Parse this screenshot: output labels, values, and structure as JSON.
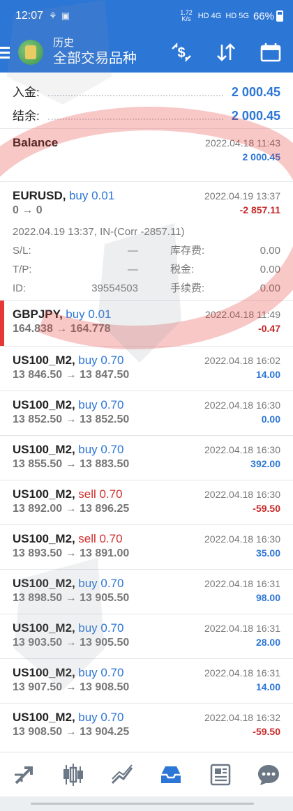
{
  "status": {
    "time": "12:07",
    "net_speed_top": "1.72",
    "net_speed_unit": "K/s",
    "signal_1": "HD 4G",
    "signal_2": "HD 5G",
    "battery": "66%"
  },
  "header": {
    "subtitle": "历史",
    "title": "全部交易品种"
  },
  "summary": {
    "deposit_label": "入金:",
    "deposit_value": "2 000.45",
    "balance_label": "结余:",
    "balance_value": "2 000.45"
  },
  "records": [
    {
      "symbol": "Balance",
      "side": "",
      "time": "2022.04.18 11:43",
      "prices": "",
      "profit": "2 000.45",
      "profit_sign": "pos"
    },
    {
      "symbol": "EURUSD,",
      "side": "buy 0.01",
      "side_type": "buy",
      "time": "2022.04.19 13:37",
      "prices": "0 → 0",
      "profit": "-2 857.11",
      "profit_sign": "neg",
      "detail_line": "2022.04.19 13:37, IN-(Corr -2857.11)",
      "sl_label": "S/L:",
      "sl_value": "—",
      "swap_label": "库存费:",
      "swap_value": "0.00",
      "tp_label": "T/P:",
      "tp_value": "—",
      "tax_label": "税金:",
      "tax_value": "0.00",
      "id_label": "ID:",
      "id_value": "39554503",
      "fee_label": "手续费:",
      "fee_value": "0.00"
    },
    {
      "symbol": "GBPJPY,",
      "side": "buy 0.01",
      "side_type": "buy",
      "time": "2022.04.18 11:49",
      "prices": "164.838 → 164.778",
      "profit": "-0.47",
      "profit_sign": "neg"
    },
    {
      "symbol": "US100_M2,",
      "side": "buy 0.70",
      "side_type": "buy",
      "time": "2022.04.18 16:02",
      "prices": "13 846.50 → 13 847.50",
      "profit": "14.00",
      "profit_sign": "pos"
    },
    {
      "symbol": "US100_M2,",
      "side": "buy 0.70",
      "side_type": "buy",
      "time": "2022.04.18 16:30",
      "prices": "13 852.50 → 13 852.50",
      "profit": "0.00",
      "profit_sign": "pos"
    },
    {
      "symbol": "US100_M2,",
      "side": "buy 0.70",
      "side_type": "buy",
      "time": "2022.04.18 16:30",
      "prices": "13 855.50 → 13 883.50",
      "profit": "392.00",
      "profit_sign": "pos"
    },
    {
      "symbol": "US100_M2,",
      "side": "sell 0.70",
      "side_type": "sell",
      "time": "2022.04.18 16:30",
      "prices": "13 892.00 → 13 896.25",
      "profit": "-59.50",
      "profit_sign": "neg"
    },
    {
      "symbol": "US100_M2,",
      "side": "sell 0.70",
      "side_type": "sell",
      "time": "2022.04.18 16:30",
      "prices": "13 893.50 → 13 891.00",
      "profit": "35.00",
      "profit_sign": "pos"
    },
    {
      "symbol": "US100_M2,",
      "side": "buy 0.70",
      "side_type": "buy",
      "time": "2022.04.18 16:31",
      "prices": "13 898.50 → 13 905.50",
      "profit": "98.00",
      "profit_sign": "pos"
    },
    {
      "symbol": "US100_M2,",
      "side": "buy 0.70",
      "side_type": "buy",
      "time": "2022.04.18 16:31",
      "prices": "13 903.50 → 13 905.50",
      "profit": "28.00",
      "profit_sign": "pos"
    },
    {
      "symbol": "US100_M2,",
      "side": "buy 0.70",
      "side_type": "buy",
      "time": "2022.04.18 16:31",
      "prices": "13 907.50 → 13 908.50",
      "profit": "14.00",
      "profit_sign": "pos"
    },
    {
      "symbol": "US100_M2,",
      "side": "buy 0.70",
      "side_type": "buy",
      "time": "2022.04.18 16:32",
      "prices": "13 908.50 → 13 904.25",
      "profit": "-59.50",
      "profit_sign": "neg"
    }
  ],
  "colors": {
    "accent": "#2c76d6",
    "negative": "#c62828",
    "selected_marker": "#e53935"
  },
  "icons": {
    "toolbar": [
      "currency-exchange-icon",
      "sort-icon",
      "calendar-icon"
    ],
    "bottom_nav": [
      "trade-arrows-icon",
      "candlestick-icon",
      "chart-line-icon",
      "history-inbox-icon",
      "news-icon",
      "chat-icon"
    ]
  }
}
